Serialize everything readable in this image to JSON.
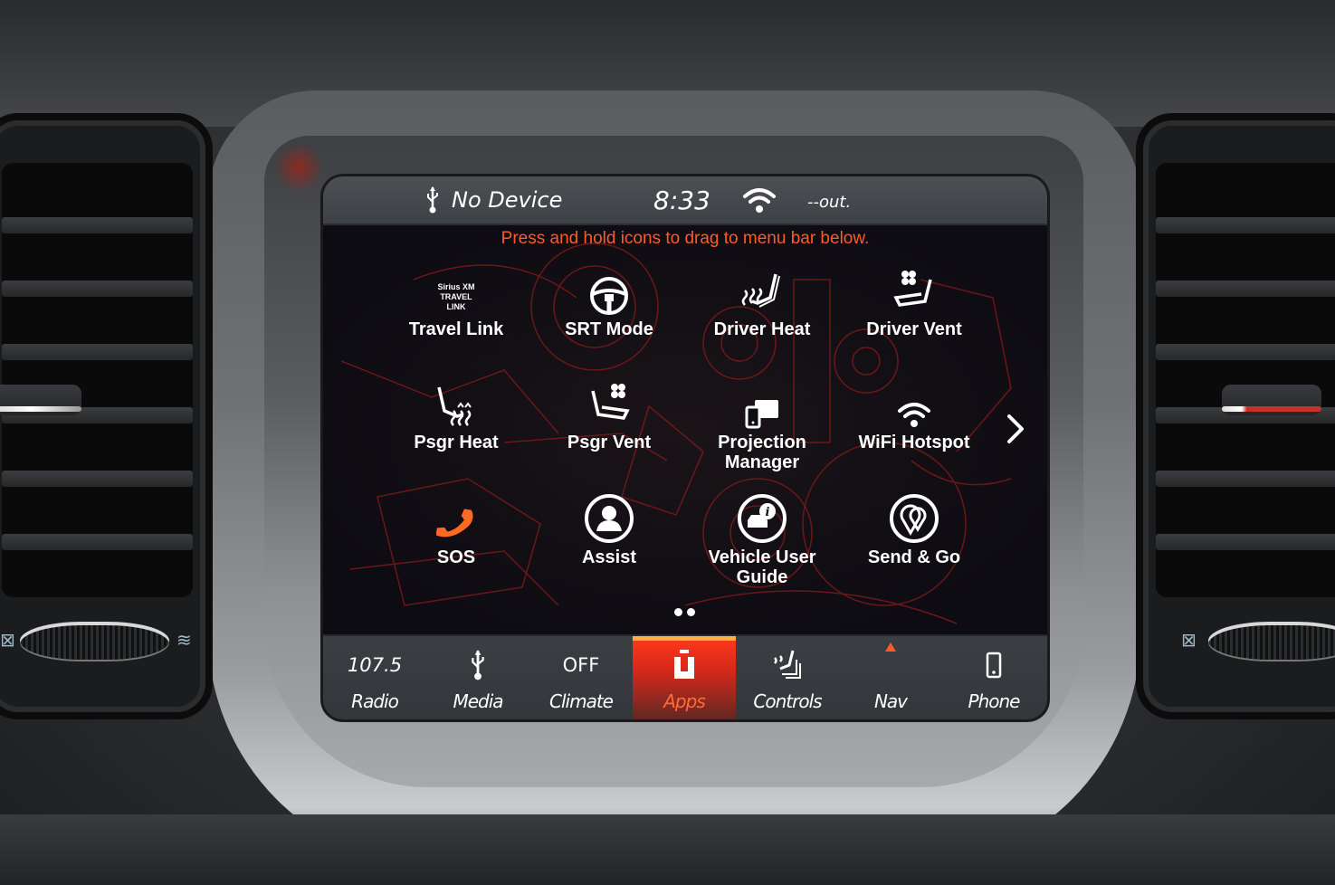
{
  "status_bar": {
    "media_icon": "usb-icon",
    "media_status": "No Device",
    "clock": "8:33",
    "wifi_icon": "wifi-icon",
    "temperature": "--out."
  },
  "hint": "Press and hold icons to drag to menu bar below.",
  "apps": [
    {
      "label": "Travel Link",
      "icon": "siriusxm-travel-link-icon",
      "icon_text": [
        "Sirius XM",
        "TRAVEL",
        "LINK"
      ]
    },
    {
      "label": "SRT Mode",
      "icon": "steering-wheel-icon"
    },
    {
      "label": "Driver Heat",
      "icon": "driver-seat-heat-icon"
    },
    {
      "label": "Driver Vent",
      "icon": "driver-seat-vent-icon"
    },
    {
      "label": "Psgr Heat",
      "icon": "passenger-seat-heat-icon"
    },
    {
      "label": "Psgr Vent",
      "icon": "passenger-seat-vent-icon"
    },
    {
      "label": "Projection Manager",
      "icon": "projection-manager-icon"
    },
    {
      "label": "WiFi Hotspot",
      "icon": "wifi-hotspot-icon"
    },
    {
      "label": "SOS",
      "icon": "phone-handset-icon"
    },
    {
      "label": "Assist",
      "icon": "assist-agent-icon"
    },
    {
      "label": "Vehicle User Guide",
      "icon": "vehicle-info-icon"
    },
    {
      "label": "Send & Go",
      "icon": "send-and-go-pin-icon"
    }
  ],
  "pager": {
    "total_pages": 2,
    "current_page": 1,
    "next_icon": "chevron-right-icon"
  },
  "nav": [
    {
      "label": "Radio",
      "top": "107.5",
      "icon": "radio-frequency"
    },
    {
      "label": "Media",
      "top": "",
      "icon": "usb-icon"
    },
    {
      "label": "Climate",
      "top": "OFF",
      "icon": "climate-status"
    },
    {
      "label": "Apps",
      "top": "",
      "icon": "uconnect-apps-icon",
      "active": true
    },
    {
      "label": "Controls",
      "top": "",
      "icon": "controls-seat-icon"
    },
    {
      "label": "Nav",
      "top": "",
      "icon": "nav-arrow-icon"
    },
    {
      "label": "Phone",
      "top": "",
      "icon": "smartphone-icon"
    }
  ],
  "colors": {
    "accent": "#ff5a2a",
    "active_tab": "#e8301c",
    "sos_icon": "#ff6a20",
    "text": "#ffffff"
  }
}
